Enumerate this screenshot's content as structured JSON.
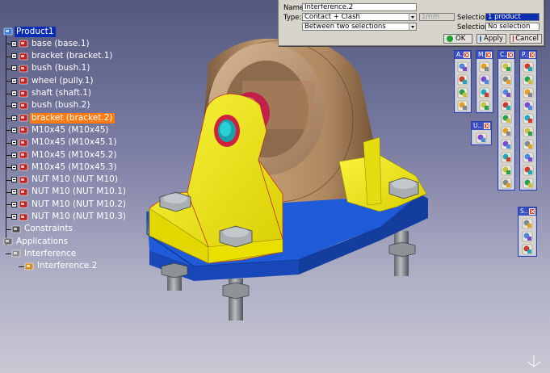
{
  "tree": {
    "items": [
      {
        "id": "product1",
        "label": "Product1",
        "kind": "product",
        "level": 0,
        "state": "selected"
      },
      {
        "id": "base",
        "label": "base (base.1)",
        "kind": "part",
        "level": 1,
        "state": ""
      },
      {
        "id": "bracket1",
        "label": "bracket (bracket.1)",
        "kind": "part",
        "level": 1,
        "state": ""
      },
      {
        "id": "bush1",
        "label": "bush (bush.1)",
        "kind": "part",
        "level": 1,
        "state": ""
      },
      {
        "id": "wheel",
        "label": "wheel (pully.1)",
        "kind": "part",
        "level": 1,
        "state": ""
      },
      {
        "id": "shaft",
        "label": "shaft (shaft.1)",
        "kind": "part",
        "level": 1,
        "state": ""
      },
      {
        "id": "bush2",
        "label": "bush (bush.2)",
        "kind": "part",
        "level": 1,
        "state": ""
      },
      {
        "id": "bracket2",
        "label": "bracket (bracket.2)",
        "kind": "part",
        "level": 1,
        "state": "highlight"
      },
      {
        "id": "m10x45",
        "label": "M10x45 (M10x45)",
        "kind": "part",
        "level": 1,
        "state": ""
      },
      {
        "id": "m10x45_1",
        "label": "M10x45 (M10x45.1)",
        "kind": "part",
        "level": 1,
        "state": ""
      },
      {
        "id": "m10x45_2",
        "label": "M10x45 (M10x45.2)",
        "kind": "part",
        "level": 1,
        "state": ""
      },
      {
        "id": "m10x45_3",
        "label": "M10x45 (M10x45.3)",
        "kind": "part",
        "level": 1,
        "state": ""
      },
      {
        "id": "nut",
        "label": "NUT M10 (NUT M10)",
        "kind": "part",
        "level": 1,
        "state": ""
      },
      {
        "id": "nut1",
        "label": "NUT M10 (NUT M10.1)",
        "kind": "part",
        "level": 1,
        "state": ""
      },
      {
        "id": "nut2",
        "label": "NUT M10 (NUT M10.2)",
        "kind": "part",
        "level": 1,
        "state": ""
      },
      {
        "id": "nut3",
        "label": "NUT M10 (NUT M10.3)",
        "kind": "part",
        "level": 1,
        "state": ""
      },
      {
        "id": "constraints",
        "label": "Constraints",
        "kind": "constraints",
        "level": 1,
        "state": ""
      },
      {
        "id": "applications",
        "label": "Applications",
        "kind": "applications",
        "level": 0,
        "state": ""
      },
      {
        "id": "interference",
        "label": "Interference",
        "kind": "folder",
        "level": 1,
        "state": ""
      },
      {
        "id": "interference2",
        "label": "Interference.2",
        "kind": "interference",
        "level": 2,
        "state": ""
      }
    ]
  },
  "dialog": {
    "name_label": "Name:",
    "name_value": "Interference.2",
    "type_label": "Type:",
    "type_value": "Contact + Clash",
    "clearance_value": "1mm",
    "mode_value": "Between two selections",
    "selection1_label": "Selection: 1",
    "selection1_value": "1 product",
    "selection2_label": "Selection: 2",
    "selection2_value": "No selection",
    "ok_label": "OK",
    "apply_label": "Apply",
    "cancel_label": "Cancel"
  },
  "toolbars": [
    {
      "id": "tb-a",
      "title": "A..",
      "icons": [
        "assembly-constraint-icon",
        "manipulation-icon",
        "snap-icon",
        "explode-icon"
      ]
    },
    {
      "id": "tb-m",
      "title": "M..",
      "icons": [
        "move-icon",
        "compass-icon",
        "translate-icon",
        "rotate-icon"
      ]
    },
    {
      "id": "tb-c",
      "title": "C..",
      "icons": [
        "clash-icon",
        "contact-icon",
        "distance-icon",
        "sectioning-icon",
        "measure-icon",
        "simulation-icon",
        "compare-icon",
        "annotation-icon",
        "apply-material-icon",
        "view-icon"
      ]
    },
    {
      "id": "tb-p",
      "title": "P..",
      "icons": [
        "existing-component-icon",
        "new-product-icon",
        "new-part-icon",
        "replace-component-icon",
        "reorder-icon",
        "multi-instantiate-icon",
        "fast-multi-instantiate-icon",
        "reuse-pattern-icon",
        "symmetry-icon",
        "manage-representation-icon"
      ]
    },
    {
      "id": "tb-u",
      "title": "U..",
      "icons": [
        "update-icon"
      ]
    },
    {
      "id": "tb-s",
      "title": "S..",
      "icons": [
        "space-analysis-icon",
        "sectioning-tool-icon",
        "graph-icon"
      ]
    }
  ],
  "colors": {
    "tree_selected": "#0a2db4",
    "tree_highlight": "#ff7a10",
    "model_yellow": "#f0e600",
    "model_blue": "#1f5ad8",
    "model_gray": "#8c9296",
    "model_tan": "#b89066",
    "toolbar_title": "#3a50c4"
  }
}
